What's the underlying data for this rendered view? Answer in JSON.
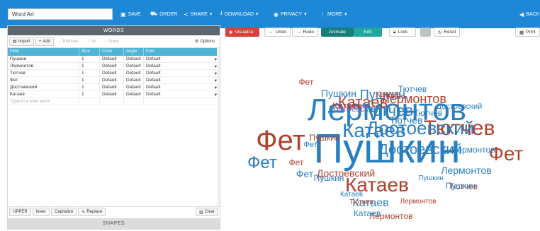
{
  "topbar": {
    "title_value": "Word Art",
    "save": "SAVE",
    "order": "ORDER",
    "share": "SHARE",
    "download": "DOWNLOAD",
    "privacy": "PRIVACY",
    "more": "MORE",
    "back": "BACK"
  },
  "words_panel": {
    "title": "WORDS",
    "import": "Import",
    "add": "Add",
    "remove": "Remove",
    "up": "Up",
    "down": "Down",
    "options": "Options",
    "columns": [
      "Filter",
      "Size",
      "Color",
      "Angle",
      "Font"
    ],
    "rows": [
      {
        "word": "Пушкин",
        "size": "1",
        "color": "Default",
        "angle": "Default",
        "font": "Default"
      },
      {
        "word": "Лермонтов",
        "size": "1",
        "color": "Default",
        "angle": "Default",
        "font": "Default"
      },
      {
        "word": "Тютчев",
        "size": "1",
        "color": "Default",
        "angle": "Default",
        "font": "Default"
      },
      {
        "word": "Фет",
        "size": "1",
        "color": "Default",
        "angle": "Default",
        "font": "Default"
      },
      {
        "word": "Достоевский",
        "size": "1",
        "color": "Default",
        "angle": "Default",
        "font": "Default"
      },
      {
        "word": "Катаев",
        "size": "1",
        "color": "Default",
        "angle": "Default",
        "font": "Default"
      }
    ],
    "new_word_placeholder": "Type in a new word",
    "upper": "UPPER",
    "lower": "lower",
    "capitalize": "Capitalize",
    "replace": "Replace",
    "clear": "Clear"
  },
  "shapes_panel": {
    "title": "SHAPES"
  },
  "canvas_toolbar": {
    "visualize": "Visualize",
    "undo": "Undo",
    "redo": "Redo",
    "animate": "Animate",
    "edit": "Edit",
    "lock": "Lock",
    "reset": "Reset",
    "print": "Print"
  },
  "colors": {
    "topbar": "#1e88d6",
    "cloud_blue": "#2a7fc0",
    "cloud_red": "#b0412e",
    "visualize_red": "#d9403a",
    "animate_teal": "#20a8a0"
  },
  "cloud_words": [
    {
      "t": "Пушкин",
      "c": "b"
    },
    {
      "t": "Лермонтов",
      "c": "b"
    },
    {
      "t": "Фет",
      "c": "r"
    },
    {
      "t": "Катаев",
      "c": "b"
    },
    {
      "t": "Тютчев",
      "c": "r"
    },
    {
      "t": "Достоевский",
      "c": "b"
    },
    {
      "t": "Пушкин",
      "c": "b"
    },
    {
      "t": "Катаев",
      "c": "r"
    },
    {
      "t": "Тютчев",
      "c": "b"
    },
    {
      "t": "Фет",
      "c": "b"
    },
    {
      "t": "Лермонтов",
      "c": "r"
    },
    {
      "t": "Достоевский",
      "c": "b"
    },
    {
      "t": "Катаев",
      "c": "r"
    },
    {
      "t": "Пушкин",
      "c": "b"
    },
    {
      "t": "Фет",
      "c": "r"
    },
    {
      "t": "Тютчев",
      "c": "b"
    },
    {
      "t": "Катаев",
      "c": "b"
    },
    {
      "t": "Лермонтов",
      "c": "b"
    },
    {
      "t": "Фет",
      "c": "r"
    },
    {
      "t": "Достоевский",
      "c": "r"
    },
    {
      "t": "Тютчев",
      "c": "r"
    },
    {
      "t": "Катаев",
      "c": "r"
    },
    {
      "t": "Пушкин",
      "c": "b"
    },
    {
      "t": "Фет",
      "c": "b"
    },
    {
      "t": "Лермонтов",
      "c": "r"
    },
    {
      "t": "Достоевский",
      "c": "b"
    },
    {
      "t": "Тютчев",
      "c": "b"
    },
    {
      "t": "Катаев",
      "c": "b"
    },
    {
      "t": "Пушкин",
      "c": "r"
    },
    {
      "t": "Фет",
      "c": "r"
    },
    {
      "t": "Катаев",
      "c": "r"
    },
    {
      "t": "Тютчев",
      "c": "b"
    },
    {
      "t": "Лермонтов",
      "c": "b"
    },
    {
      "t": "Пушкин",
      "c": "b"
    },
    {
      "t": "Фет",
      "c": "b"
    },
    {
      "t": "Достоевский",
      "c": "b"
    },
    {
      "t": "Катаев",
      "c": "b"
    },
    {
      "t": "Тютчев",
      "c": "r"
    },
    {
      "t": "Лермонтов",
      "c": "r"
    },
    {
      "t": "Пушкин",
      "c": "b"
    }
  ]
}
